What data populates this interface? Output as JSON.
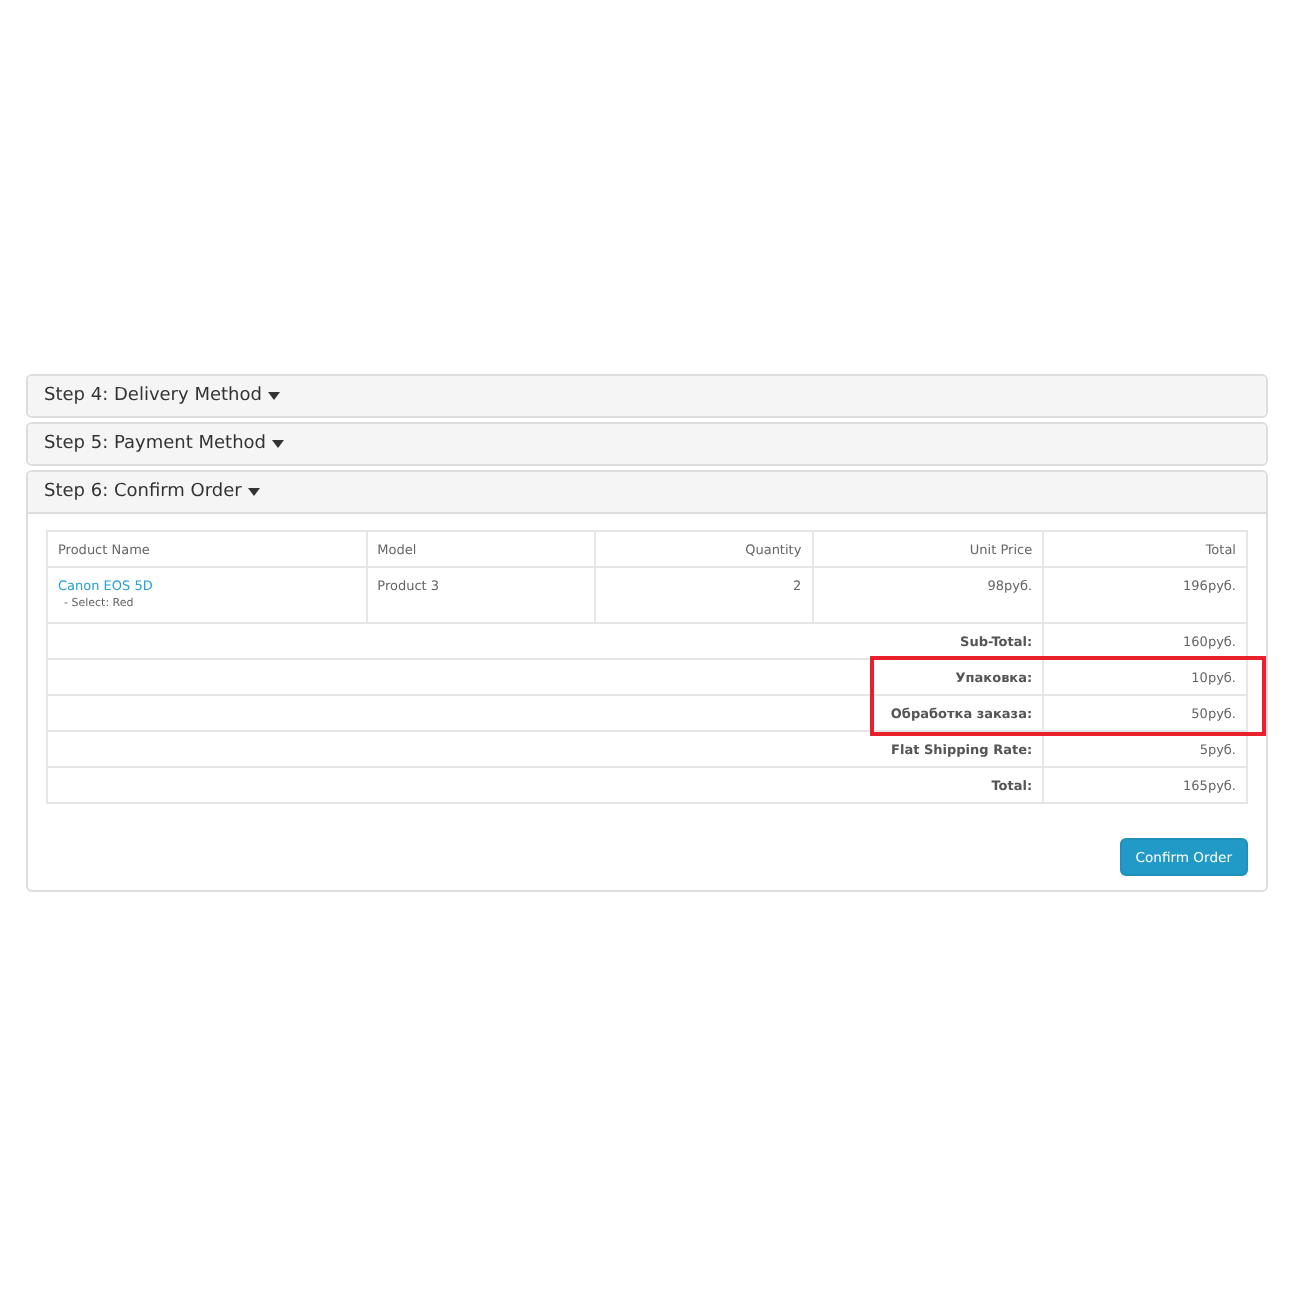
{
  "steps": [
    {
      "title": "Step 4: Delivery Method",
      "expanded": false
    },
    {
      "title": "Step 5: Payment Method",
      "expanded": false
    },
    {
      "title": "Step 6: Confirm Order",
      "expanded": true
    }
  ],
  "table": {
    "columns": [
      "Product Name",
      "Model",
      "Quantity",
      "Unit Price",
      "Total"
    ],
    "rows": [
      {
        "name": "Canon EOS 5D",
        "option": "- Select: Red",
        "model": "Product 3",
        "quantity": "2",
        "unit_price": "98руб.",
        "total": "196руб."
      }
    ]
  },
  "totals": [
    {
      "label": "Sub-Total:",
      "value": "160руб.",
      "highlighted": false
    },
    {
      "label": "Упаковка:",
      "value": "10руб.",
      "highlighted": true
    },
    {
      "label": "Обработка заказа:",
      "value": "50руб.",
      "highlighted": true
    },
    {
      "label": "Flat Shipping Rate:",
      "value": "5руб.",
      "highlighted": false
    },
    {
      "label": "Total:",
      "value": "165руб.",
      "highlighted": false
    }
  ],
  "confirm_button": "Confirm Order"
}
